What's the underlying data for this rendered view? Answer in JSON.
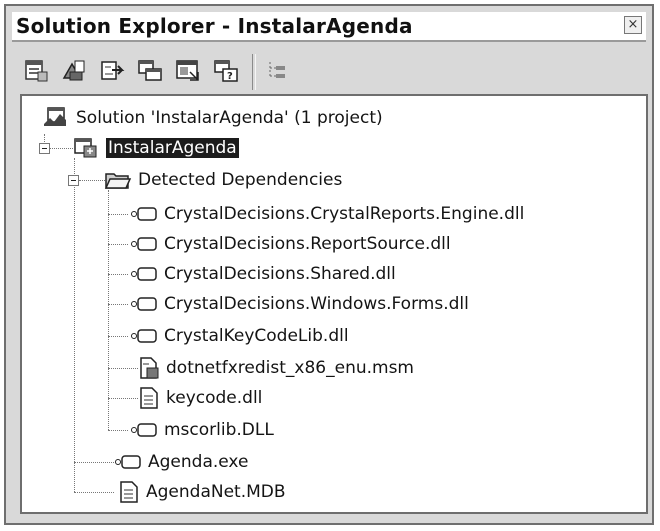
{
  "window": {
    "title": "Solution Explorer - InstalarAgenda",
    "close_glyph": "×"
  },
  "toolbar": {
    "buttons": [
      {
        "icon": "properties-icon"
      },
      {
        "icon": "show-all-files-icon"
      },
      {
        "icon": "refresh-icon"
      },
      {
        "icon": "copy-project-icon"
      },
      {
        "icon": "view-code-icon"
      },
      {
        "icon": "view-designer-icon"
      },
      {
        "icon": "custom-actions-editor-icon"
      }
    ]
  },
  "tree": {
    "solution": "Solution 'InstalarAgenda' (1 project)",
    "project": "InstalarAgenda",
    "detected_dependencies": "Detected Dependencies",
    "dependencies": [
      "CrystalDecisions.CrystalReports.Engine.dll",
      "CrystalDecisions.ReportSource.dll",
      "CrystalDecisions.Shared.dll",
      "CrystalDecisions.Windows.Forms.dll",
      "CrystalKeyCodeLib.dll",
      "dotnetfxredist_x86_enu.msm",
      "keycode.dll",
      "mscorlib.DLL"
    ],
    "outputs": [
      "Agenda.exe",
      "AgendaNet.MDB"
    ]
  }
}
